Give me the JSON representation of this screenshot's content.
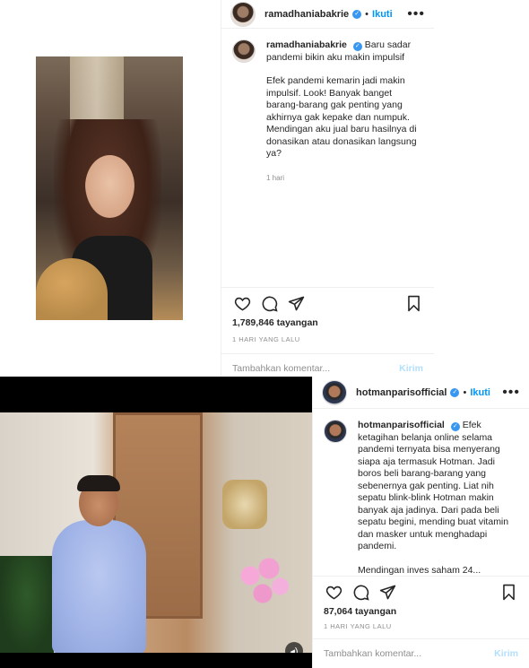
{
  "posts": [
    {
      "username": "ramadhaniabakrie",
      "follow_label": "Ikuti",
      "dot": "•",
      "caption_title": "Baru sadar pandemi bikin aku makin impulsif",
      "caption_body": "Efek pandemi kemarin jadi makin impulsif. Look! Banyak banget barang-barang gak penting yang akhirnya gak kepake dan numpuk. Mendingan aku jual baru hasilnya di donasikan atau donasikan langsung ya?",
      "time_ago": "1 hari",
      "views": "1,789,846 tayangan",
      "date": "1 HARI YANG LALU",
      "comment_placeholder": "Tambahkan komentar...",
      "send_label": "Kirim"
    },
    {
      "username": "hotmanparisofficial",
      "follow_label": "Ikuti",
      "dot": "•",
      "caption_body": "Efek ketagihan belanja online selama pandemi ternyata bisa menyerang siapa aja termasuk Hotman. Jadi boros beli barang-barang yang sebenernya gak penting. Liat nih sepatu blink-blink Hotman makin banyak aja jadinya. Dari pada beli sepatu begini, mending buat vitamin dan masker untuk menghadapi pandemi.",
      "caption_cut": "Mendingan inves saham 24...",
      "views": "87,064 tayangan",
      "date": "1 HARI YANG LALU",
      "comment_placeholder": "Tambahkan komentar...",
      "send_label": "Kirim",
      "sound_icon": "speaker-icon"
    }
  ],
  "icons": {
    "more": "more-options-icon",
    "like": "heart-icon",
    "comment": "comment-icon",
    "share": "paper-plane-icon",
    "save": "bookmark-icon",
    "verified": "verified-badge-icon"
  },
  "colors": {
    "accent": "#0095f6",
    "verified": "#3897f0",
    "muted": "#8e8e8e",
    "send_disabled": "#b2dffc"
  }
}
